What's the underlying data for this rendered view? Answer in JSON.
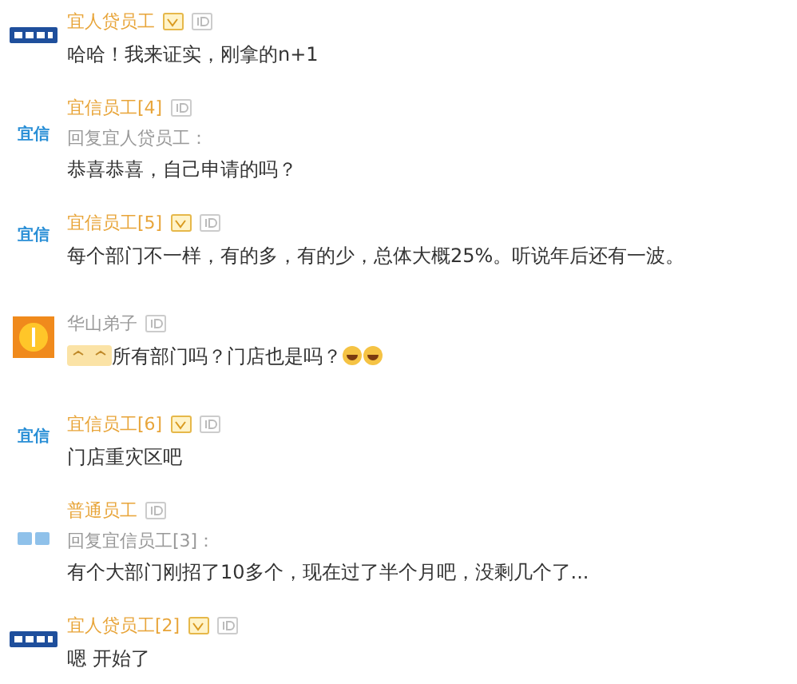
{
  "comments": [
    {
      "avatar": {
        "kind": "banner-logo"
      },
      "name": "宜人贷员工",
      "color": "#e8a53a",
      "vip": true,
      "message": "哈哈！我来证实，刚拿的n+1"
    },
    {
      "avatar": {
        "kind": "text-logo",
        "label": "宜信"
      },
      "name": "宜信员工[4]",
      "color": "#e8a53a",
      "vip": false,
      "reply_to": "回复宜人贷员工：",
      "message": "恭喜恭喜，自己申请的吗？"
    },
    {
      "avatar": {
        "kind": "text-logo",
        "label": "宜信"
      },
      "name": "宜信员工[5]",
      "color": "#e8a53a",
      "vip": true,
      "message": "每个部门不一样，有的多，有的少，总体大概25%。听说年后还有一波。"
    },
    {
      "avatar": {
        "kind": "coin"
      },
      "name": "华山弟子",
      "color": "#9a9a9a",
      "vip": false,
      "emoji_before": [
        {
          "kind": "squint"
        }
      ],
      "message": "所有部门吗？门店也是吗？",
      "emoji_after": [
        {
          "kind": "grin"
        },
        {
          "kind": "grin"
        }
      ]
    },
    {
      "avatar": {
        "kind": "text-logo",
        "label": "宜信"
      },
      "name": "宜信员工[6]",
      "color": "#e8a53a",
      "vip": true,
      "message": "门店重灾区吧"
    },
    {
      "avatar": {
        "kind": "faded-logo"
      },
      "name": "普通员工",
      "color": "#e8a53a",
      "vip": false,
      "reply_to": "回复宜信员工[3]：",
      "message": "有个大部门刚招了10多个，现在过了半个月吧，没剩几个了..."
    },
    {
      "avatar": {
        "kind": "banner-logo"
      },
      "name": "宜人贷员工[2]",
      "color": "#e8a53a",
      "vip": true,
      "message": "嗯 开始了"
    }
  ]
}
